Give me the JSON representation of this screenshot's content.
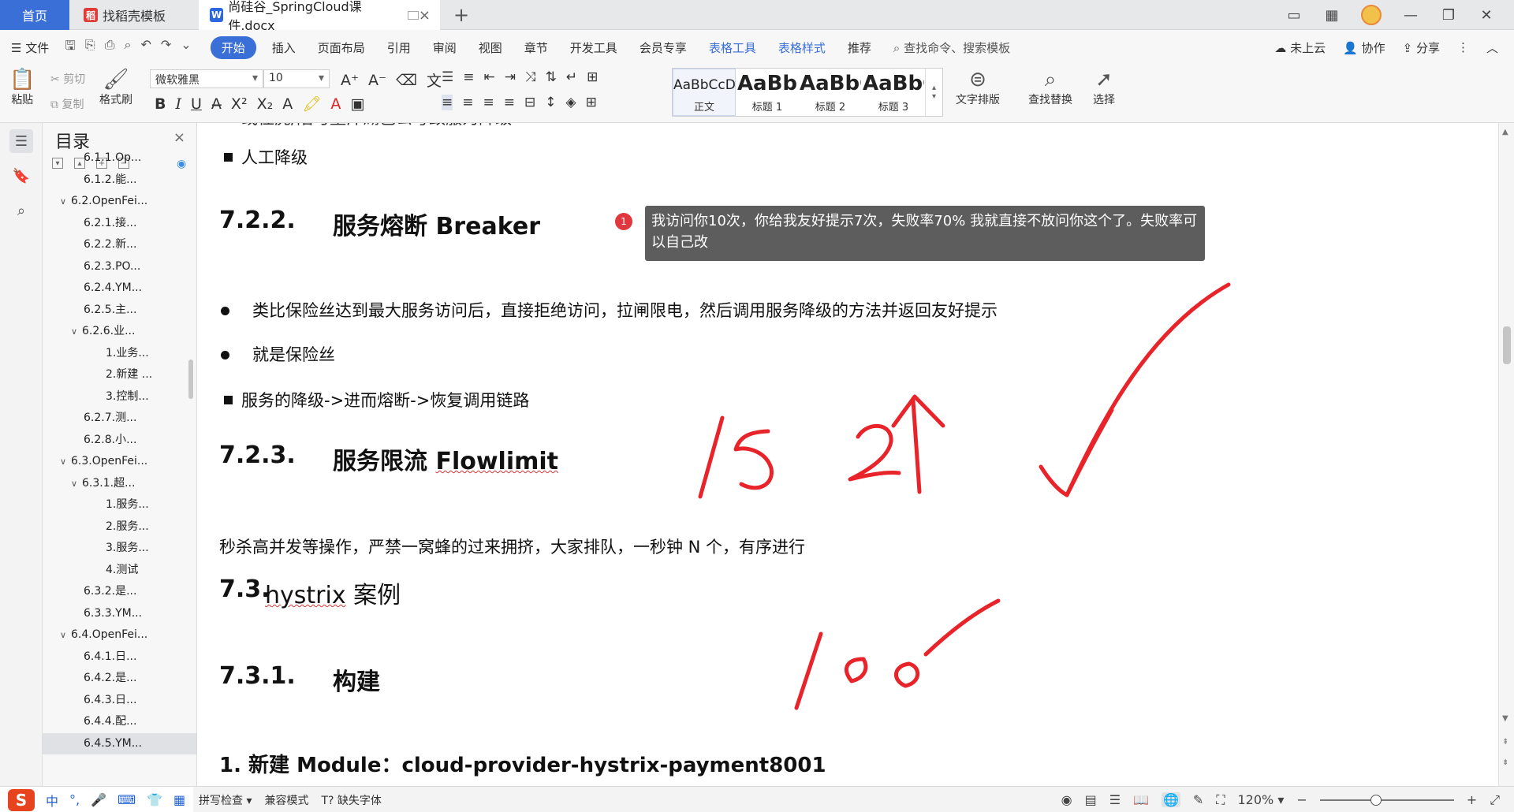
{
  "tabs": [
    {
      "label": "首页"
    },
    {
      "label": "找稻壳模板"
    },
    {
      "label": "尚硅谷_SpringCloud课件.docx"
    }
  ],
  "menu": {
    "file": "文件",
    "items": [
      "开始",
      "插入",
      "页面布局",
      "引用",
      "审阅",
      "视图",
      "章节",
      "开发工具",
      "会员专享",
      "表格工具",
      "表格样式",
      "推荐"
    ],
    "search": "查找命令、搜索模板",
    "cloud": "未上云",
    "collab": "协作",
    "share": "分享"
  },
  "ribbon": {
    "paste": "粘贴",
    "cut": "剪切",
    "copy": "复制",
    "format_painter": "格式刷",
    "font_name": "微软雅黑",
    "font_size": "10",
    "styles": [
      {
        "sample": "AaBbCcDd",
        "name": "正文"
      },
      {
        "sample": "AaBb",
        "name": "标题 1"
      },
      {
        "sample": "AaBbC",
        "name": "标题 2"
      },
      {
        "sample": "AaBbC",
        "name": "标题 3"
      }
    ],
    "text_layout": "文字排版",
    "find_replace": "查找替换",
    "select": "选择"
  },
  "outline": {
    "title": "目录",
    "items": [
      {
        "label": "6.1.1.Op...",
        "level": 2,
        "caret": ""
      },
      {
        "label": "6.1.2.能...",
        "level": 2,
        "caret": ""
      },
      {
        "label": "6.2.OpenFei...",
        "level": 1,
        "caret": "v"
      },
      {
        "label": "6.2.1.接...",
        "level": 2,
        "caret": ""
      },
      {
        "label": "6.2.2.新...",
        "level": 2,
        "caret": ""
      },
      {
        "label": "6.2.3.PO...",
        "level": 2,
        "caret": ""
      },
      {
        "label": "6.2.4.YM...",
        "level": 2,
        "caret": ""
      },
      {
        "label": "6.2.5.主...",
        "level": 2,
        "caret": ""
      },
      {
        "label": "6.2.6.业...",
        "level": 2,
        "caret": "v"
      },
      {
        "label": "1.业务...",
        "level": 3,
        "caret": ""
      },
      {
        "label": "2.新建 ...",
        "level": 3,
        "caret": ""
      },
      {
        "label": "3.控制...",
        "level": 3,
        "caret": ""
      },
      {
        "label": "6.2.7.测...",
        "level": 2,
        "caret": ""
      },
      {
        "label": "6.2.8.小...",
        "level": 2,
        "caret": ""
      },
      {
        "label": "6.3.OpenFei...",
        "level": 1,
        "caret": "v"
      },
      {
        "label": "6.3.1.超...",
        "level": 2,
        "caret": "v"
      },
      {
        "label": "1.服务...",
        "level": 3,
        "caret": ""
      },
      {
        "label": "2.服务...",
        "level": 3,
        "caret": ""
      },
      {
        "label": "3.服务...",
        "level": 3,
        "caret": ""
      },
      {
        "label": "4.测试",
        "level": 3,
        "caret": ""
      },
      {
        "label": "6.3.2.是...",
        "level": 2,
        "caret": ""
      },
      {
        "label": "6.3.3.YM...",
        "level": 2,
        "caret": ""
      },
      {
        "label": "6.4.OpenFei...",
        "level": 1,
        "caret": "v"
      },
      {
        "label": "6.4.1.日...",
        "level": 2,
        "caret": ""
      },
      {
        "label": "6.4.2.是...",
        "level": 2,
        "caret": ""
      },
      {
        "label": "6.4.3.日...",
        "level": 2,
        "caret": ""
      },
      {
        "label": "6.4.4.配...",
        "level": 2,
        "caret": ""
      },
      {
        "label": "6.4.5.YM...",
        "level": 2,
        "caret": "",
        "selected": true
      }
    ]
  },
  "document": {
    "cut_top_line": "或住虎/陷与垄斤湖己公号致服为降级",
    "manual_degrade": "人工降级",
    "h_722_num": "7.2.2.",
    "h_722_text": "服务熔断 Breaker",
    "bullet_1": "类比保险丝达到最大服务访问后，直接拒绝访问，拉闸限电，然后调用服务降级的方法并返回友好提示",
    "bullet_2": "就是保险丝",
    "sub_bullet": "服务的降级->进而熔断->恢复调用链路",
    "h_723_num": "7.2.3.",
    "h_723_text_a": "服务限流 ",
    "h_723_text_b": "Flowlimit",
    "flowlimit_para": "秒杀高并发等操作，严禁一窝蜂的过来拥挤，大家排队，一秒钟 N 个，有序进行",
    "h_73_num": "7.3.",
    "h_73_text_a": "hystrix",
    "h_73_text_b": " 案例",
    "h_731_num": "7.3.1.",
    "h_731_text": "构建",
    "step_1": "1.  新建 Module：cloud-provider-hystrix-payment8001"
  },
  "comment": {
    "badge": "1",
    "text": "我访问你10次，你给我友好提示7次，失败率70% 我就直接不放问你这个了。失败率可以自己改"
  },
  "status": {
    "ime_logo": "S",
    "ime_lang": "中",
    "spell_check": "拼写检查",
    "compat_mode": "兼容模式",
    "missing_font": "缺失字体",
    "zoom": "120%",
    "zoom_level_fraction": 0.42
  },
  "colors": {
    "accent": "#3a6fd8",
    "ink": "#e8242a",
    "comment_bg": "#5d5d5d",
    "badge": "#e0383e"
  }
}
